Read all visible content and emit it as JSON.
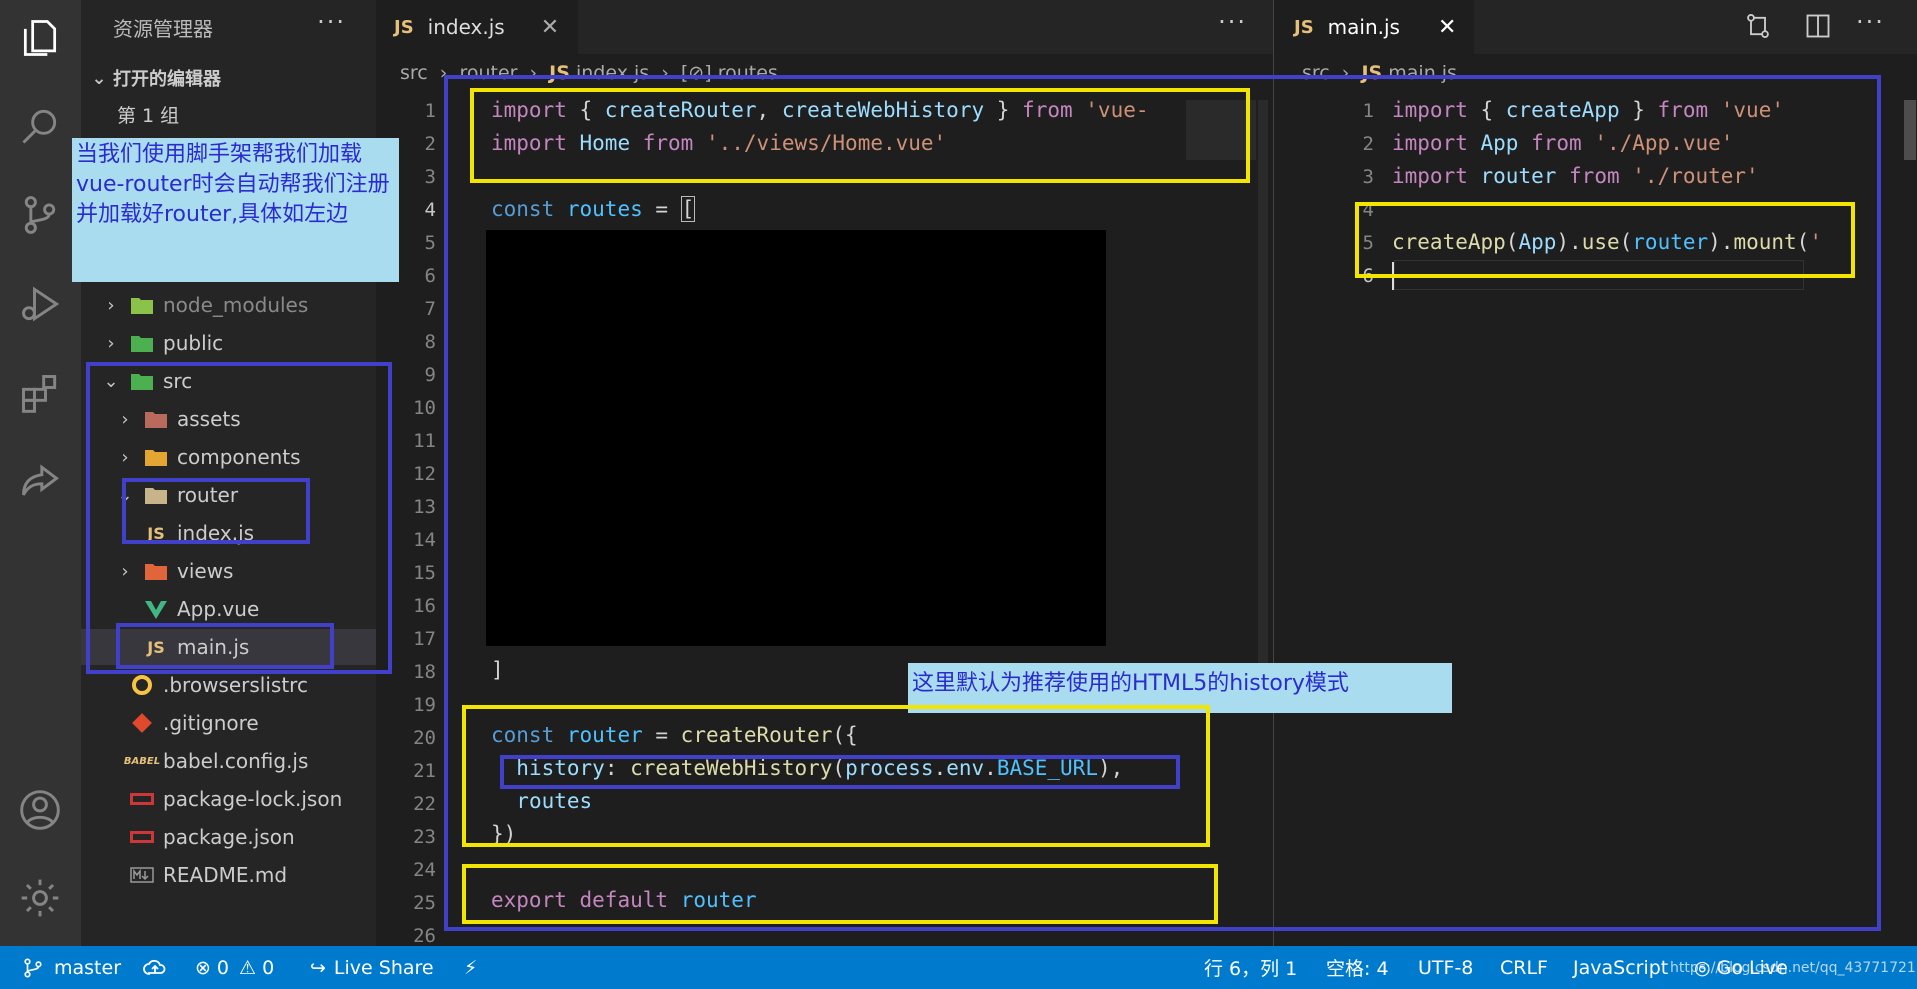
{
  "activity": {
    "icons": [
      "files-icon",
      "search-icon",
      "source-control-icon",
      "run-debug-icon",
      "extensions-icon",
      "live-share-icon",
      "account-icon",
      "settings-gear-icon"
    ]
  },
  "explorer": {
    "title": "资源管理器",
    "more": "···",
    "open_editors": "打开的编辑器",
    "group": "第 1 组",
    "items": [
      {
        "label": "node_modules",
        "icon": "node-folder-icon"
      },
      {
        "label": "public",
        "icon": "public-folder-icon"
      },
      {
        "label": "src",
        "icon": "src-folder-icon"
      },
      {
        "label": "assets",
        "icon": "assets-folder-icon"
      },
      {
        "label": "components",
        "icon": "components-folder-icon"
      },
      {
        "label": "router",
        "icon": "folder-open-icon"
      },
      {
        "label": "index.js",
        "icon": "js-file-icon"
      },
      {
        "label": "views",
        "icon": "views-folder-icon"
      },
      {
        "label": "App.vue",
        "icon": "vue-file-icon"
      },
      {
        "label": "main.js",
        "icon": "js-file-icon"
      },
      {
        "label": ".browserslistrc",
        "icon": "browserslist-icon"
      },
      {
        "label": ".gitignore",
        "icon": "git-icon"
      },
      {
        "label": "babel.config.js",
        "icon": "babel-icon"
      },
      {
        "label": "package-lock.json",
        "icon": "npm-icon"
      },
      {
        "label": "package.json",
        "icon": "npm-icon"
      },
      {
        "label": "README.md",
        "icon": "markdown-icon"
      }
    ]
  },
  "annotations": {
    "left_note": "当我们使用脚手架帮我们加载vue-router时会自动帮我们注册并加载好router,具体如左边",
    "history_note": "这里默认为推荐使用的HTML5的history模式"
  },
  "editor1": {
    "tab": "index.js",
    "js_badge": "JS",
    "more": "···",
    "breadcrumb": {
      "a": "src",
      "b": "router",
      "c": "index.js",
      "d": "routes"
    },
    "line_numbers": [
      "1",
      "2",
      "3",
      "4",
      "5",
      "6",
      "7",
      "8",
      "9",
      "10",
      "11",
      "12",
      "13",
      "14",
      "15",
      "16",
      "17",
      "18",
      "19",
      "20",
      "21",
      "22",
      "23",
      "24",
      "25",
      "26"
    ],
    "code": {
      "l1": "import { createRouter, createWebHistory } from 'vue-",
      "l2": "import Home from '../views/Home.vue'",
      "l4": "const routes = [",
      "l18": "]",
      "l20": "const router = createRouter({",
      "l21": "  history: createWebHistory(process.env.BASE_URL),",
      "l22": "  routes",
      "l23": "})",
      "l25": "export default router"
    }
  },
  "editor2": {
    "tab": "main.js",
    "js_badge": "JS",
    "breadcrumb": {
      "a": "src",
      "b": "main.js"
    },
    "line_numbers": [
      "1",
      "2",
      "3",
      "4",
      "5",
      "6"
    ],
    "code": {
      "l1": "import { createApp } from 'vue'",
      "l2": "import App from './App.vue'",
      "l3": "import router from './router'",
      "l5": "createApp(App).use(router).mount('"
    }
  },
  "statusbar": {
    "branch": "master",
    "errors": "0",
    "warnings": "0",
    "live_share": "Live Share",
    "position": "行 6，列 1",
    "spaces": "空格: 4",
    "encoding": "UTF-8",
    "eol": "CRLF",
    "language": "JavaScript",
    "go_live": "Go Live",
    "watermark": "https://blog.csdn.net/qq_43771721"
  },
  "colors": {
    "accent": "#007acc",
    "highlight_yellow": "#f2e600",
    "highlight_blue": "#4040c8",
    "note_bg": "#a9dcee"
  }
}
